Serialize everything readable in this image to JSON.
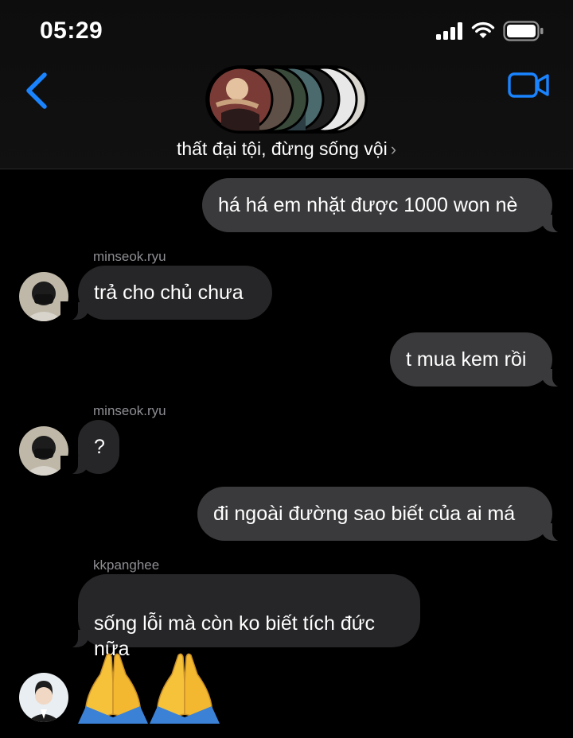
{
  "status_bar": {
    "time": "05:29"
  },
  "conversation": {
    "name": "thất đại tội, đừng sống vội",
    "chevron": "›"
  },
  "messages": [
    {
      "direction": "out",
      "text": "há há em nhặt được 1000 won nè"
    },
    {
      "direction": "in",
      "sender": "minseok.ryu",
      "text": "trả cho chủ chưa"
    },
    {
      "direction": "out",
      "text": "t mua kem rồi"
    },
    {
      "direction": "in",
      "sender": "minseok.ryu",
      "text": "?"
    },
    {
      "direction": "out",
      "text": "đi ngoài đường sao biết của ai má"
    },
    {
      "direction": "in",
      "sender": "kkpanghee",
      "text": "sống lỗi mà còn ko biết tích đức\nnữa"
    },
    {
      "direction": "in",
      "sender": "kkpanghee",
      "emoji": "folded-hands-x2"
    }
  ],
  "icons": {
    "back": "chevron-left-icon",
    "video": "video-camera-icon",
    "signal": "cellular-signal-icon",
    "wifi": "wifi-icon",
    "battery": "battery-icon"
  },
  "colors": {
    "accent": "#1a84ff",
    "bubble_out": "#3a3a3c",
    "bubble_in": "#262628",
    "sender_name": "#8e8e93"
  }
}
